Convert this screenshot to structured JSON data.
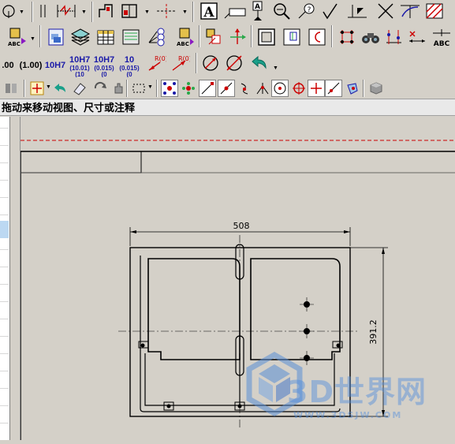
{
  "toolbar_row3": {
    "tol1": ".00",
    "tol2": "(1.00)",
    "tol3": "10H7",
    "tol4_main": "10H7",
    "tol4_sub1": "(10.01)",
    "tol4_sub2": "(10",
    "tol5_main": "10H7",
    "tol5_sub1": "(0.015)",
    "tol5_sub2": "(0",
    "tol6_main": "10",
    "tol6_sub1": "(0.015)",
    "tol6_sub2": "(0",
    "radius_label": "R(0)",
    "radius2_label": "R(0)"
  },
  "toolbar_row1": {
    "question_mark": "?",
    "text_A": "A",
    "text_A2": "A"
  },
  "toolbar_row2": {
    "abc_label": "ABC",
    "abc_label2": "ABC",
    "abc_big": "ABC"
  },
  "status": {
    "message": "拖动来移动视图、尺寸或注释"
  },
  "drawing": {
    "width_dim": "508",
    "height_dim": "391.2"
  },
  "watermark": {
    "brand": "3D世界网",
    "url": "WWW.3DSJW.COM"
  },
  "colors": {
    "toolbar_bg": "#d4d0c8",
    "accent_red": "#cc0000",
    "accent_blue": "#1a1aa8",
    "watermark_blue": "#5a8fd6"
  }
}
